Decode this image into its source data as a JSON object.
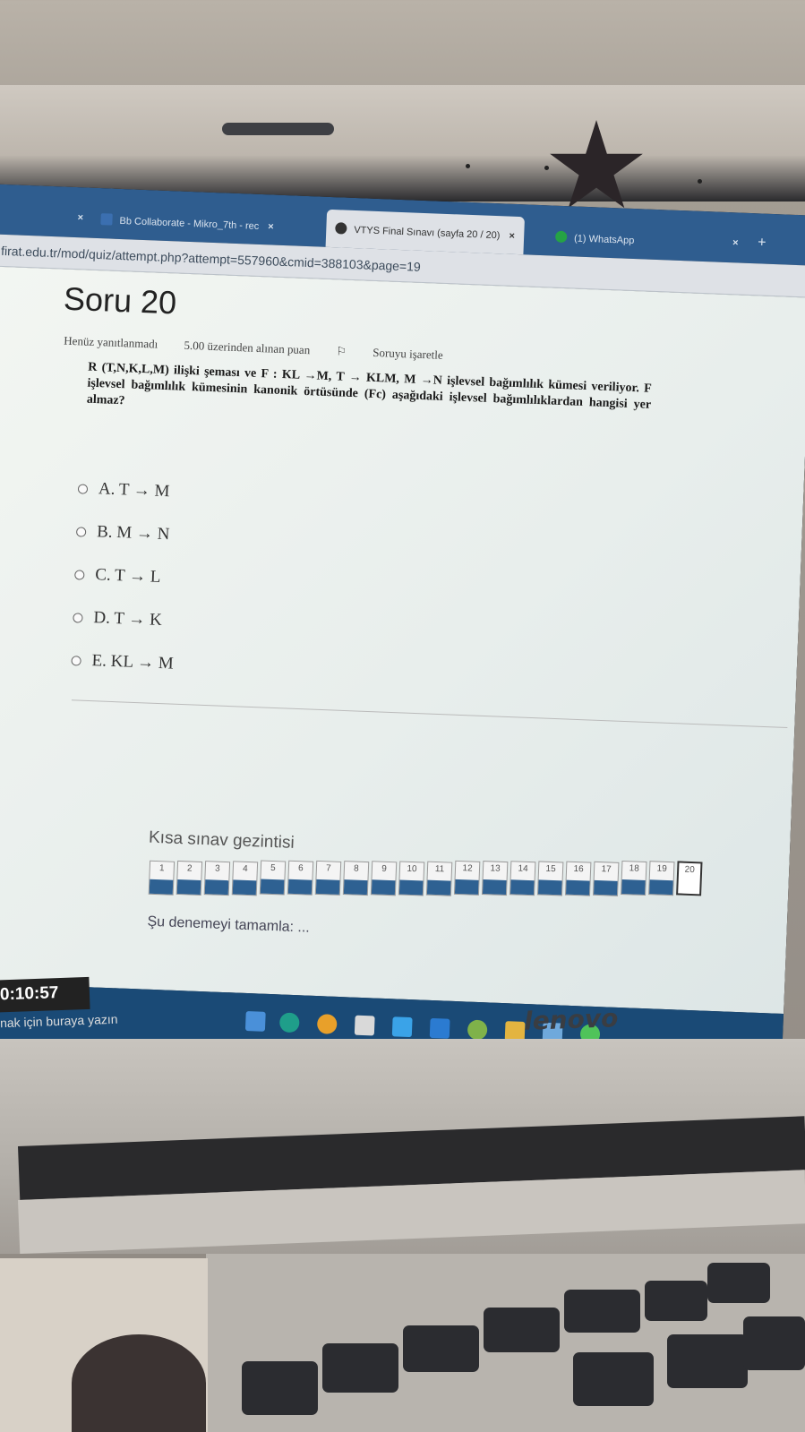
{
  "browser": {
    "tabs": [
      {
        "label": "",
        "close": "×"
      },
      {
        "label": "Bb Collaborate - Mikro_7th - rec",
        "close": "×"
      },
      {
        "label": "VTYS Final Sınavı (sayfa 20 / 20)",
        "close": "×"
      },
      {
        "label": "(1) WhatsApp",
        "close": "×"
      }
    ],
    "new_tab": "+",
    "url": "firat.edu.tr/mod/quiz/attempt.php?attempt=557960&cmid=388103&page=19"
  },
  "question": {
    "title": "Soru 20",
    "status": "Henüz yanıtlanmadı",
    "points": "5.00 üzerinden alınan puan",
    "flag": "Soruyu işaretle",
    "text": "R (T,N,K,L,M) ilişki şeması ve F : KL →M, T → KLM, M →N işlevsel bağımlılık kümesi veriliyor. F işlevsel bağımlılık kümesinin kanonik örtüsünde (Fc) aşağıdaki işlevsel bağımlılıklardan hangisi yer almaz?",
    "options": [
      "A. T → M",
      "B. M → N",
      "C. T → L",
      "D. T → K",
      "E. KL → M"
    ]
  },
  "navigation": {
    "title": "Kısa sınav gezintisi",
    "buttons": [
      "1",
      "2",
      "3",
      "4",
      "5",
      "6",
      "7",
      "8",
      "9",
      "10",
      "11",
      "12",
      "13",
      "14",
      "15",
      "16",
      "17",
      "18",
      "19",
      "20"
    ],
    "current": "20",
    "finish": "Şu denemeyi tamamla: ..."
  },
  "timer": "0:10:57",
  "taskbar_search": "nak için buraya yazın",
  "brand": "lenovo"
}
